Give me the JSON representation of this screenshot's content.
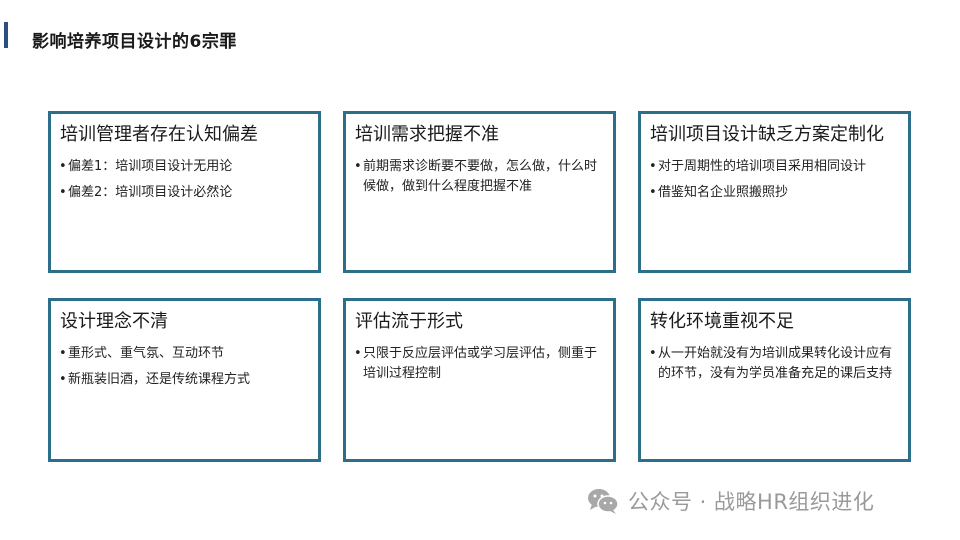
{
  "page": {
    "title": "影响培养项目设计的6宗罪"
  },
  "cards": [
    {
      "title": "培训管理者存在认知偏差",
      "items": [
        "偏差1：培训项目设计无用论",
        "偏差2：培训项目设计必然论"
      ]
    },
    {
      "title": "培训需求把握不准",
      "items": [
        "前期需求诊断要不要做，怎么做，什么时候做，做到什么程度把握不准"
      ]
    },
    {
      "title": "培训项目设计缺乏方案定制化",
      "items": [
        "对于周期性的培训项目采用相同设计",
        "借鉴知名企业照搬照抄"
      ]
    },
    {
      "title": "设计理念不清",
      "items": [
        "重形式、重气氛、互动环节",
        "新瓶装旧酒，还是传统课程方式"
      ]
    },
    {
      "title": "评估流于形式",
      "items": [
        "只限于反应层评估或学习层评估，侧重于培训过程控制"
      ]
    },
    {
      "title": "转化环境重视不足",
      "items": [
        "从一开始就没有为培训成果转化设计应有的环节，没有为学员准备充足的课后支持"
      ]
    }
  ],
  "bullet": "•",
  "watermark": {
    "icon": "wechat-icon",
    "text": "公众号 · 战略HR组织进化"
  },
  "colors": {
    "card_border": "#2b6f8a",
    "title_accent": "#2c4f82",
    "watermark": "#9a9a9a"
  }
}
